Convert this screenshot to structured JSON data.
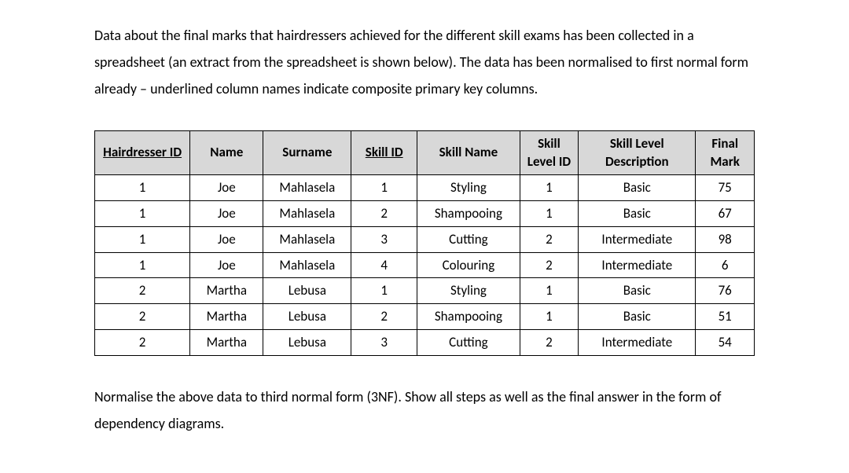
{
  "intro": "Data about the final marks that hairdressers achieved for the different skill exams has been collected in a spreadsheet (an extract from the spreadsheet is shown below). The data has been normalised to first normal form already – underlined column names indicate composite primary key columns.",
  "outro": "Normalise the above data to third normal form (3NF). Show all steps as well as the final answer in the form of dependency diagrams.",
  "table": {
    "headers": [
      {
        "label": "Hairdresser ID",
        "underline": true
      },
      {
        "label": "Name",
        "underline": false
      },
      {
        "label": "Surname",
        "underline": false
      },
      {
        "label": "Skill ID",
        "underline": true
      },
      {
        "label": "Skill Name",
        "underline": false
      },
      {
        "label": "Skill Level ID",
        "underline": false
      },
      {
        "label": "Skill Level Description",
        "underline": false
      },
      {
        "label": "Final Mark",
        "underline": false
      }
    ],
    "rows": [
      [
        "1",
        "Joe",
        "Mahlasela",
        "1",
        "Styling",
        "1",
        "Basic",
        "75"
      ],
      [
        "1",
        "Joe",
        "Mahlasela",
        "2",
        "Shampooing",
        "1",
        "Basic",
        "67"
      ],
      [
        "1",
        "Joe",
        "Mahlasela",
        "3",
        "Cutting",
        "2",
        "Intermediate",
        "98"
      ],
      [
        "1",
        "Joe",
        "Mahlasela",
        "4",
        "Colouring",
        "2",
        "Intermediate",
        "6"
      ],
      [
        "2",
        "Martha",
        "Lebusa",
        "1",
        "Styling",
        "1",
        "Basic",
        "76"
      ],
      [
        "2",
        "Martha",
        "Lebusa",
        "2",
        "Shampooing",
        "1",
        "Basic",
        "51"
      ],
      [
        "2",
        "Martha",
        "Lebusa",
        "3",
        "Cutting",
        "2",
        "Intermediate",
        "54"
      ]
    ]
  },
  "chart_data": {
    "type": "table",
    "title": "Hairdresser skill exam marks (1NF extract)",
    "columns": [
      "Hairdresser ID",
      "Name",
      "Surname",
      "Skill ID",
      "Skill Name",
      "Skill Level ID",
      "Skill Level Description",
      "Final Mark"
    ],
    "primary_key": [
      "Hairdresser ID",
      "Skill ID"
    ],
    "rows": [
      {
        "Hairdresser ID": 1,
        "Name": "Joe",
        "Surname": "Mahlasela",
        "Skill ID": 1,
        "Skill Name": "Styling",
        "Skill Level ID": 1,
        "Skill Level Description": "Basic",
        "Final Mark": 75
      },
      {
        "Hairdresser ID": 1,
        "Name": "Joe",
        "Surname": "Mahlasela",
        "Skill ID": 2,
        "Skill Name": "Shampooing",
        "Skill Level ID": 1,
        "Skill Level Description": "Basic",
        "Final Mark": 67
      },
      {
        "Hairdresser ID": 1,
        "Name": "Joe",
        "Surname": "Mahlasela",
        "Skill ID": 3,
        "Skill Name": "Cutting",
        "Skill Level ID": 2,
        "Skill Level Description": "Intermediate",
        "Final Mark": 98
      },
      {
        "Hairdresser ID": 1,
        "Name": "Joe",
        "Surname": "Mahlasela",
        "Skill ID": 4,
        "Skill Name": "Colouring",
        "Skill Level ID": 2,
        "Skill Level Description": "Intermediate",
        "Final Mark": 6
      },
      {
        "Hairdresser ID": 2,
        "Name": "Martha",
        "Surname": "Lebusa",
        "Skill ID": 1,
        "Skill Name": "Styling",
        "Skill Level ID": 1,
        "Skill Level Description": "Basic",
        "Final Mark": 76
      },
      {
        "Hairdresser ID": 2,
        "Name": "Martha",
        "Surname": "Lebusa",
        "Skill ID": 2,
        "Skill Name": "Shampooing",
        "Skill Level ID": 1,
        "Skill Level Description": "Basic",
        "Final Mark": 51
      },
      {
        "Hairdresser ID": 2,
        "Name": "Martha",
        "Surname": "Lebusa",
        "Skill ID": 3,
        "Skill Name": "Cutting",
        "Skill Level ID": 2,
        "Skill Level Description": "Intermediate",
        "Final Mark": 54
      }
    ]
  }
}
